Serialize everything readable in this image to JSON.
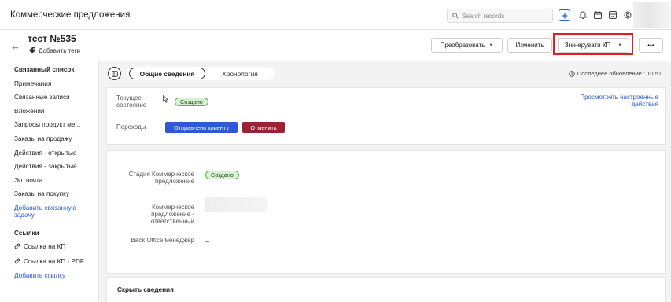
{
  "app": {
    "title": "Коммерческие предложения",
    "search_placeholder": "Search records"
  },
  "header": {
    "record_title": "тест №535",
    "add_tags": "Добавить теги",
    "buttons": {
      "convert": "Преобразовать",
      "edit": "Изменить",
      "generate": "Згенерувати КП",
      "more": "•••"
    }
  },
  "sidebar": {
    "related_list_title": "Связанный список",
    "items": [
      "Примечания",
      "Связанные записи",
      "Вложения",
      "Запросы продукт ме...",
      "Заказы на продажу",
      "Действия - открытые",
      "Действия - закрытые",
      "Эл. почта",
      "Заказы на покупку"
    ],
    "add_related_task": "Добавить связанную задачу",
    "links_title": "Ссылки",
    "links": [
      "Ссылка на КП",
      "Ссылка на КП - PDF"
    ],
    "add_link": "Добавить ссылку"
  },
  "tabs": {
    "overview": "Общие сведения",
    "timeline": "Хронология"
  },
  "last_update": "Последнее обновление : 10:51",
  "state_card": {
    "current_state_label": "Текущее состояние",
    "current_state_value": "Создано",
    "view_settings": "Просмотреть настроенные действия",
    "transitions_label": "Переходы",
    "sent_to_client": "Отправлено клиенту",
    "cancel": "Отменить"
  },
  "details": {
    "stage_label": "Стадия Коммерческое предложение",
    "stage_value": "Создано",
    "responsible_label": "Коммерческое предложение - ответственный",
    "back_office_label": "Back Office менеджер",
    "back_office_value": "–"
  },
  "hide_details": "Скрыть сведения",
  "colors": {
    "accent_blue": "#2f57d8",
    "cancel_red": "#9b2335",
    "status_green_bg": "#d8f1d2",
    "highlight_red": "#e02020"
  }
}
